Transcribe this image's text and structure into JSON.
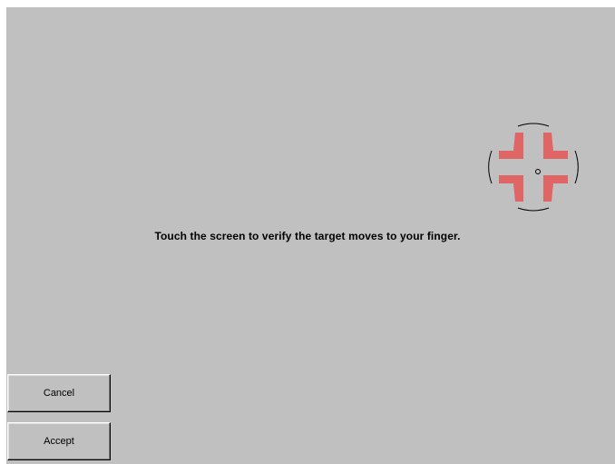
{
  "instruction": "Touch the screen to verify the target moves to your finger.",
  "buttons": {
    "cancel": "Cancel",
    "accept": "Accept"
  },
  "target": {
    "icon": "calibration-crosshair-icon",
    "arrow_color": "#e06666",
    "ring_color": "#000000"
  },
  "colors": {
    "background": "#c0c0c0"
  }
}
